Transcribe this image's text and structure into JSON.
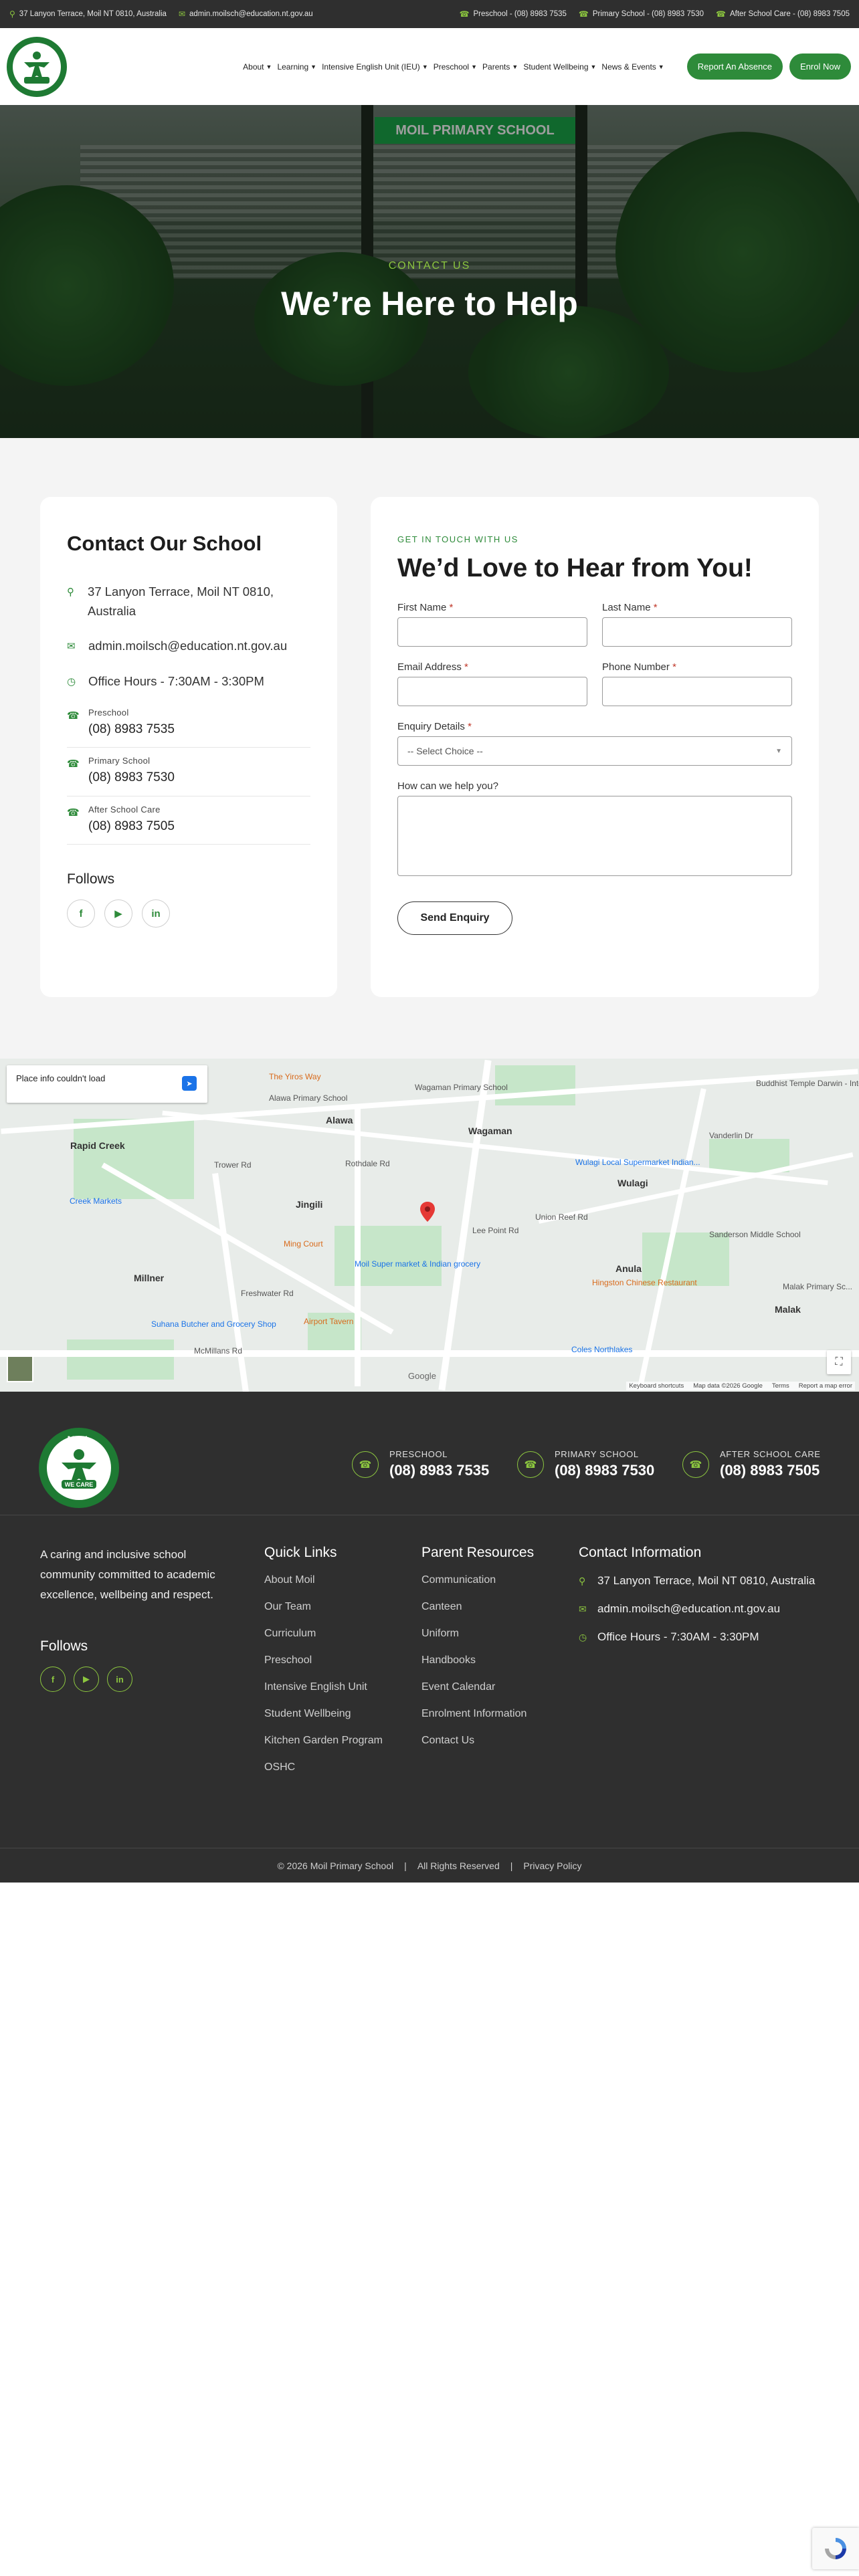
{
  "topbar": {
    "address": "37 Lanyon Terrace, Moil NT 0810, Australia",
    "email": "admin.moilsch@education.nt.gov.au",
    "phones": [
      "Preschool - (08) 8983 7535",
      "Primary School - (08) 8983 7530",
      "After School Care - (08) 8983 7505"
    ]
  },
  "header": {
    "logo_text": "MOIL",
    "logo_motto": "WE CARE",
    "nav": [
      "About",
      "Learning",
      "Intensive English Unit (IEU)",
      "Preschool",
      "Parents",
      "Student Wellbeing",
      "News & Events"
    ],
    "report_absence": "Report An Absence",
    "enrol_now": "Enrol Now"
  },
  "hero": {
    "sign": "MOIL PRIMARY SCHOOL",
    "eyebrow": "CONTACT US",
    "title": "We’re Here to Help"
  },
  "contact_card": {
    "title": "Contact Our School",
    "address": "37 Lanyon Terrace, Moil NT 0810, Australia",
    "email": "admin.moilsch@education.nt.gov.au",
    "hours": "Office Hours - 7:30AM - 3:30PM",
    "phones": [
      {
        "label": "Preschool",
        "number": "(08) 8983 7535"
      },
      {
        "label": "Primary School",
        "number": "(08) 8983 7530"
      },
      {
        "label": "After School Care",
        "number": "(08) 8983 7505"
      }
    ],
    "follows": "Follows"
  },
  "form": {
    "eyebrow": "GET IN TOUCH WITH US",
    "title": "We’d Love to Hear from You!",
    "first_name": "First Name",
    "last_name": "Last Name",
    "email": "Email Address",
    "phone": "Phone Number",
    "enquiry": "Enquiry Details",
    "enquiry_select": "-- Select Choice --",
    "message": "How can we help you?",
    "send": "Send Enquiry",
    "required_mark": "*"
  },
  "map": {
    "info": "Place info couldn't load",
    "labels": {
      "rapid_creek": "Rapid Creek",
      "alawa": "Alawa",
      "wagaman": "Wagaman",
      "jingili": "Jingili",
      "wulagi": "Wulagi",
      "anula": "Anula",
      "millner": "Millner",
      "malak": "Malak",
      "yiros": "The Yiros Way",
      "alawa_ps": "Alawa Primary School",
      "wagaman_ps": "Wagaman Primary School",
      "buddhist": "Buddhist Temple Darwin - International",
      "wulagi_super": "Wulagi Local Supermarket Indian...",
      "sanderson": "Sanderson Middle School",
      "ming": "Ming Court",
      "moil_super": "Moil Super market & Indian grocery",
      "hingston": "Hingston Chinese Restaurant",
      "airport": "Airport Tavern",
      "suhana": "Suhana Butcher and Grocery Shop",
      "coles": "Coles Northlakes",
      "malak_ps": "Malak Primary Sc...",
      "creek_markets": "Creek Markets",
      "trower": "Trower Rd",
      "mcmillans": "McMillans Rd",
      "vanderlin": "Vanderlin Dr",
      "lee_point": "Lee Point Rd",
      "union": "Union Reef Rd",
      "freshwater": "Freshwater Rd",
      "rothdale": "Rothdale Rd"
    },
    "keyboard": "Keyboard shortcuts",
    "mapdata": "Map data ©2026 Google",
    "terms": "Terms",
    "report": "Report a map error",
    "google": "Google"
  },
  "footer": {
    "phones": [
      {
        "label": "PRESCHOOL",
        "number": "(08) 8983 7535"
      },
      {
        "label": "PRIMARY SCHOOL",
        "number": "(08) 8983 7530"
      },
      {
        "label": "AFTER SCHOOL CARE",
        "number": "(08) 8983 7505"
      }
    ],
    "about": "A caring and inclusive school community committed to academic excellence, wellbeing and respect.",
    "follows": "Follows",
    "quick_links_title": "Quick Links",
    "quick_links": [
      "About Moil",
      "Our Team",
      "Curriculum",
      "Preschool",
      "Intensive English Unit",
      "Student Wellbeing",
      "Kitchen Garden Program",
      "OSHC"
    ],
    "parent_title": "Parent Resources",
    "parent_links": [
      "Communication",
      "Canteen",
      "Uniform",
      "Handbooks",
      "Event Calendar",
      "Enrolment Information",
      "Contact Us"
    ],
    "contact_title": "Contact Information",
    "contact_address": "37 Lanyon Terrace, Moil NT 0810, Australia",
    "contact_email": "admin.moilsch@education.nt.gov.au",
    "contact_hours": "Office Hours - 7:30AM - 3:30PM",
    "copyright": "© 2026 Moil Primary School",
    "sep": "|",
    "rights": "All Rights Reserved",
    "privacy": "Privacy Policy"
  },
  "colors": {
    "accent": "#2e8b3a",
    "accent_light": "#8cc63f",
    "dark": "#2f2f2f"
  }
}
